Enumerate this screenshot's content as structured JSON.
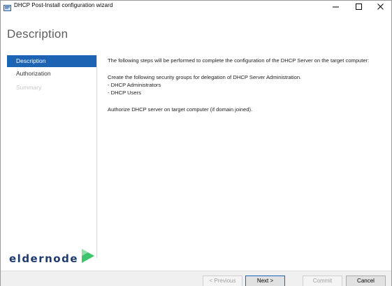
{
  "window": {
    "title": "DHCP Post-Install configuration wizard"
  },
  "page": {
    "heading": "Description"
  },
  "nav": {
    "items": [
      {
        "label": "Description",
        "state": "active"
      },
      {
        "label": "Authorization",
        "state": "normal"
      },
      {
        "label": "Summary",
        "state": "disabled"
      }
    ]
  },
  "content": {
    "intro": "The following steps will be performed to complete the configuration of the DHCP Server on the target computer:",
    "groups_lead": "Create the following security groups for delegation of DHCP Server Administration.",
    "groups": [
      "- DHCP Administrators",
      "- DHCP Users"
    ],
    "authorize": "Authorize DHCP server on target computer (if domain joined)."
  },
  "logo": {
    "text": "eldernode"
  },
  "footer": {
    "previous_label": "< Previous",
    "next_label": "Next >",
    "commit_label": "Commit",
    "cancel_label": "Cancel"
  },
  "colors": {
    "accent": "#1c63b4",
    "heading": "#5d5d5d",
    "disabled_text": "#c9c9c9",
    "logo": "#1e3b6e",
    "logo_arrow": "#3ec46d"
  },
  "icons": {
    "app": "dhcp-wizard-icon",
    "minimize": "minimize-icon",
    "maximize": "maximize-icon",
    "close": "close-icon",
    "logo_arrow": "play-arrow-icon"
  }
}
